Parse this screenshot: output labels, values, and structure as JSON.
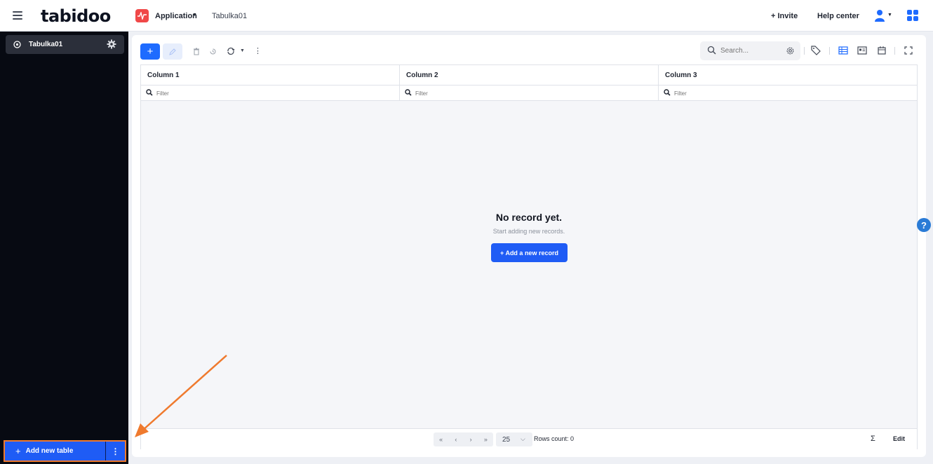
{
  "topbar": {
    "logo": "tabidoo",
    "app_name": "Application",
    "breadcrumb": "Tabulka01",
    "invite": "+ Invite",
    "help": "Help center"
  },
  "sidebar": {
    "items": [
      {
        "label": "Tabulka01"
      }
    ],
    "add_table": "Add new table"
  },
  "toolbar": {
    "add_icon": "plus-icon",
    "search_placeholder": "Search..."
  },
  "table": {
    "columns": [
      "Column 1",
      "Column 2",
      "Column 3"
    ],
    "filter_placeholder": "Filter"
  },
  "empty": {
    "title": "No record yet.",
    "subtitle": "Start adding new records.",
    "button": "+ Add a new record"
  },
  "footer": {
    "page_size": "25",
    "rows_count": "Rows count: 0",
    "sum_symbol": "Σ",
    "edit": "Edit"
  },
  "help_bubble": "?",
  "colors": {
    "accent": "#1f5cf5",
    "highlight": "#ef7a2e",
    "sidebar_bg": "#070a12"
  }
}
